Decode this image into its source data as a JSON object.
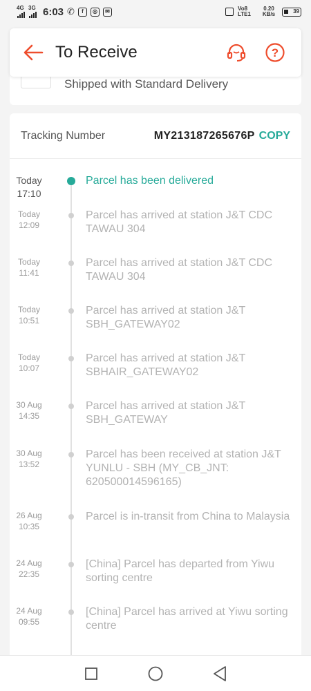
{
  "status_bar": {
    "time": "6:03",
    "net1": "4G",
    "net2": "3G",
    "volte": "Vo8 LTE1",
    "speed": "0.20 KB/s",
    "battery": "39"
  },
  "header": {
    "title": "To Receive"
  },
  "shipping": {
    "method": "Shipped with Standard Delivery"
  },
  "tracking": {
    "label": "Tracking Number",
    "number": "MY213187265676P",
    "copy_label": "COPY"
  },
  "events": [
    {
      "date": "Today",
      "time": "17:10",
      "text": "Parcel has been delivered",
      "current": true
    },
    {
      "date": "Today",
      "time": "12:09",
      "text": "Parcel has arrived at station J&T CDC TAWAU 304"
    },
    {
      "date": "Today",
      "time": "11:41",
      "text": "Parcel has arrived at station J&T CDC TAWAU 304"
    },
    {
      "date": "Today",
      "time": "10:51",
      "text": "Parcel has arrived at station J&T SBH_GATEWAY02"
    },
    {
      "date": "Today",
      "time": "10:07",
      "text": "Parcel has arrived at station J&T SBHAIR_GATEWAY02"
    },
    {
      "date": "30 Aug",
      "time": "14:35",
      "text": "Parcel has arrived at station J&T SBH_GATEWAY"
    },
    {
      "date": "30 Aug",
      "time": "13:52",
      "text": "Parcel has been received at station J&T YUNLU - SBH (MY_CB_JNT: 620500014596165)"
    },
    {
      "date": "26 Aug",
      "time": "10:35",
      "text": "Parcel is in-transit from China to Malaysia"
    },
    {
      "date": "24 Aug",
      "time": "22:35",
      "text": "[China] Parcel has departed from Yiwu sorting centre"
    },
    {
      "date": "24 Aug",
      "time": "09:55",
      "text": "[China] Parcel has arrived at Yiwu sorting centre"
    }
  ],
  "colors": {
    "accent": "#ee4d2d",
    "success": "#26aa99"
  }
}
